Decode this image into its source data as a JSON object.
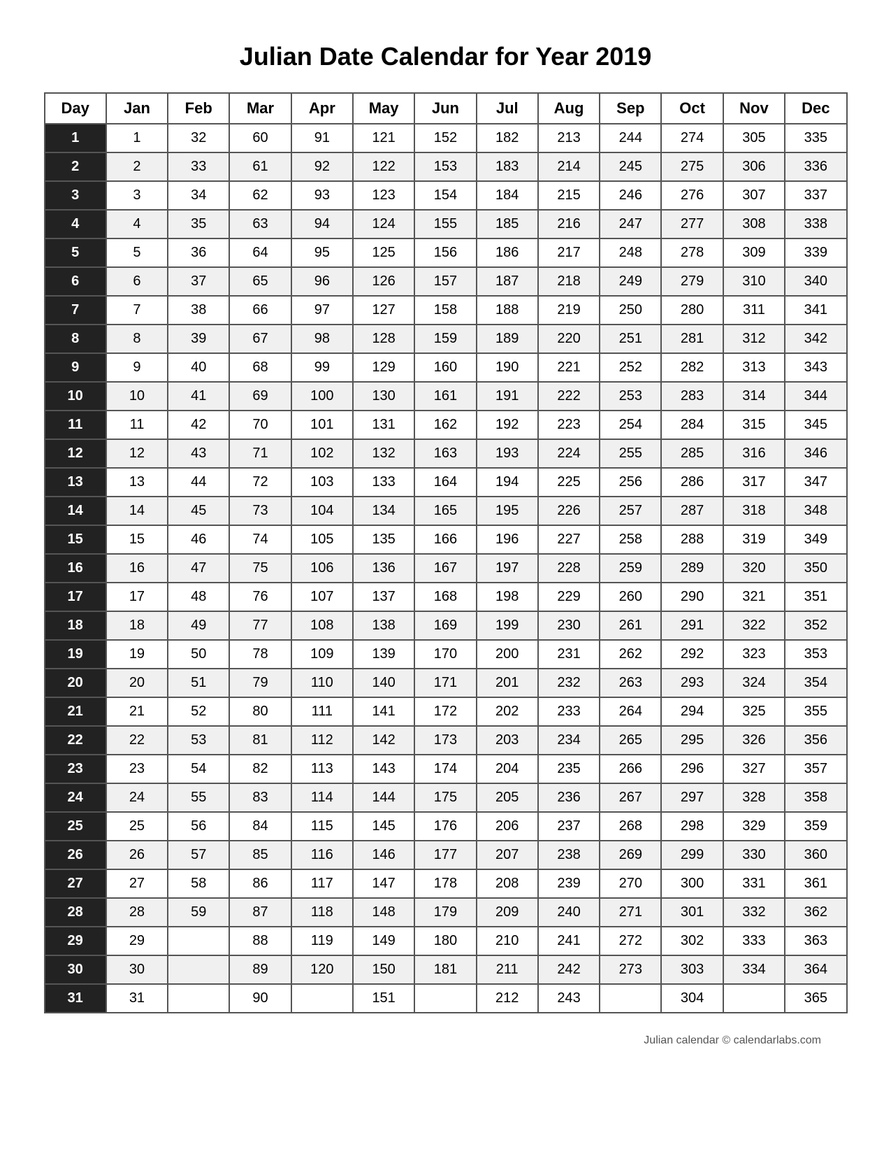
{
  "title": "Julian Date Calendar for Year 2019",
  "footer": "Julian calendar © calendarlabs.com",
  "headers": [
    "Day",
    "Jan",
    "Feb",
    "Mar",
    "Apr",
    "May",
    "Jun",
    "Jul",
    "Aug",
    "Sep",
    "Oct",
    "Nov",
    "Dec"
  ],
  "rows": [
    {
      "day": 1,
      "jan": 1,
      "feb": 32,
      "mar": 60,
      "apr": 91,
      "may": 121,
      "jun": 152,
      "jul": 182,
      "aug": 213,
      "sep": 244,
      "oct": 274,
      "nov": 305,
      "dec": 335
    },
    {
      "day": 2,
      "jan": 2,
      "feb": 33,
      "mar": 61,
      "apr": 92,
      "may": 122,
      "jun": 153,
      "jul": 183,
      "aug": 214,
      "sep": 245,
      "oct": 275,
      "nov": 306,
      "dec": 336
    },
    {
      "day": 3,
      "jan": 3,
      "feb": 34,
      "mar": 62,
      "apr": 93,
      "may": 123,
      "jun": 154,
      "jul": 184,
      "aug": 215,
      "sep": 246,
      "oct": 276,
      "nov": 307,
      "dec": 337
    },
    {
      "day": 4,
      "jan": 4,
      "feb": 35,
      "mar": 63,
      "apr": 94,
      "may": 124,
      "jun": 155,
      "jul": 185,
      "aug": 216,
      "sep": 247,
      "oct": 277,
      "nov": 308,
      "dec": 338
    },
    {
      "day": 5,
      "jan": 5,
      "feb": 36,
      "mar": 64,
      "apr": 95,
      "may": 125,
      "jun": 156,
      "jul": 186,
      "aug": 217,
      "sep": 248,
      "oct": 278,
      "nov": 309,
      "dec": 339
    },
    {
      "day": 6,
      "jan": 6,
      "feb": 37,
      "mar": 65,
      "apr": 96,
      "may": 126,
      "jun": 157,
      "jul": 187,
      "aug": 218,
      "sep": 249,
      "oct": 279,
      "nov": 310,
      "dec": 340
    },
    {
      "day": 7,
      "jan": 7,
      "feb": 38,
      "mar": 66,
      "apr": 97,
      "may": 127,
      "jun": 158,
      "jul": 188,
      "aug": 219,
      "sep": 250,
      "oct": 280,
      "nov": 311,
      "dec": 341
    },
    {
      "day": 8,
      "jan": 8,
      "feb": 39,
      "mar": 67,
      "apr": 98,
      "may": 128,
      "jun": 159,
      "jul": 189,
      "aug": 220,
      "sep": 251,
      "oct": 281,
      "nov": 312,
      "dec": 342
    },
    {
      "day": 9,
      "jan": 9,
      "feb": 40,
      "mar": 68,
      "apr": 99,
      "may": 129,
      "jun": 160,
      "jul": 190,
      "aug": 221,
      "sep": 252,
      "oct": 282,
      "nov": 313,
      "dec": 343
    },
    {
      "day": 10,
      "jan": 10,
      "feb": 41,
      "mar": 69,
      "apr": 100,
      "may": 130,
      "jun": 161,
      "jul": 191,
      "aug": 222,
      "sep": 253,
      "oct": 283,
      "nov": 314,
      "dec": 344
    },
    {
      "day": 11,
      "jan": 11,
      "feb": 42,
      "mar": 70,
      "apr": 101,
      "may": 131,
      "jun": 162,
      "jul": 192,
      "aug": 223,
      "sep": 254,
      "oct": 284,
      "nov": 315,
      "dec": 345
    },
    {
      "day": 12,
      "jan": 12,
      "feb": 43,
      "mar": 71,
      "apr": 102,
      "may": 132,
      "jun": 163,
      "jul": 193,
      "aug": 224,
      "sep": 255,
      "oct": 285,
      "nov": 316,
      "dec": 346
    },
    {
      "day": 13,
      "jan": 13,
      "feb": 44,
      "mar": 72,
      "apr": 103,
      "may": 133,
      "jun": 164,
      "jul": 194,
      "aug": 225,
      "sep": 256,
      "oct": 286,
      "nov": 317,
      "dec": 347
    },
    {
      "day": 14,
      "jan": 14,
      "feb": 45,
      "mar": 73,
      "apr": 104,
      "may": 134,
      "jun": 165,
      "jul": 195,
      "aug": 226,
      "sep": 257,
      "oct": 287,
      "nov": 318,
      "dec": 348
    },
    {
      "day": 15,
      "jan": 15,
      "feb": 46,
      "mar": 74,
      "apr": 105,
      "may": 135,
      "jun": 166,
      "jul": 196,
      "aug": 227,
      "sep": 258,
      "oct": 288,
      "nov": 319,
      "dec": 349
    },
    {
      "day": 16,
      "jan": 16,
      "feb": 47,
      "mar": 75,
      "apr": 106,
      "may": 136,
      "jun": 167,
      "jul": 197,
      "aug": 228,
      "sep": 259,
      "oct": 289,
      "nov": 320,
      "dec": 350
    },
    {
      "day": 17,
      "jan": 17,
      "feb": 48,
      "mar": 76,
      "apr": 107,
      "may": 137,
      "jun": 168,
      "jul": 198,
      "aug": 229,
      "sep": 260,
      "oct": 290,
      "nov": 321,
      "dec": 351
    },
    {
      "day": 18,
      "jan": 18,
      "feb": 49,
      "mar": 77,
      "apr": 108,
      "may": 138,
      "jun": 169,
      "jul": 199,
      "aug": 230,
      "sep": 261,
      "oct": 291,
      "nov": 322,
      "dec": 352
    },
    {
      "day": 19,
      "jan": 19,
      "feb": 50,
      "mar": 78,
      "apr": 109,
      "may": 139,
      "jun": 170,
      "jul": 200,
      "aug": 231,
      "sep": 262,
      "oct": 292,
      "nov": 323,
      "dec": 353
    },
    {
      "day": 20,
      "jan": 20,
      "feb": 51,
      "mar": 79,
      "apr": 110,
      "may": 140,
      "jun": 171,
      "jul": 201,
      "aug": 232,
      "sep": 263,
      "oct": 293,
      "nov": 324,
      "dec": 354
    },
    {
      "day": 21,
      "jan": 21,
      "feb": 52,
      "mar": 80,
      "apr": 111,
      "may": 141,
      "jun": 172,
      "jul": 202,
      "aug": 233,
      "sep": 264,
      "oct": 294,
      "nov": 325,
      "dec": 355
    },
    {
      "day": 22,
      "jan": 22,
      "feb": 53,
      "mar": 81,
      "apr": 112,
      "may": 142,
      "jun": 173,
      "jul": 203,
      "aug": 234,
      "sep": 265,
      "oct": 295,
      "nov": 326,
      "dec": 356
    },
    {
      "day": 23,
      "jan": 23,
      "feb": 54,
      "mar": 82,
      "apr": 113,
      "may": 143,
      "jun": 174,
      "jul": 204,
      "aug": 235,
      "sep": 266,
      "oct": 296,
      "nov": 327,
      "dec": 357
    },
    {
      "day": 24,
      "jan": 24,
      "feb": 55,
      "mar": 83,
      "apr": 114,
      "may": 144,
      "jun": 175,
      "jul": 205,
      "aug": 236,
      "sep": 267,
      "oct": 297,
      "nov": 328,
      "dec": 358
    },
    {
      "day": 25,
      "jan": 25,
      "feb": 56,
      "mar": 84,
      "apr": 115,
      "may": 145,
      "jun": 176,
      "jul": 206,
      "aug": 237,
      "sep": 268,
      "oct": 298,
      "nov": 329,
      "dec": 359
    },
    {
      "day": 26,
      "jan": 26,
      "feb": 57,
      "mar": 85,
      "apr": 116,
      "may": 146,
      "jun": 177,
      "jul": 207,
      "aug": 238,
      "sep": 269,
      "oct": 299,
      "nov": 330,
      "dec": 360
    },
    {
      "day": 27,
      "jan": 27,
      "feb": 58,
      "mar": 86,
      "apr": 117,
      "may": 147,
      "jun": 178,
      "jul": 208,
      "aug": 239,
      "sep": 270,
      "oct": 300,
      "nov": 331,
      "dec": 361
    },
    {
      "day": 28,
      "jan": 28,
      "feb": 59,
      "mar": 87,
      "apr": 118,
      "may": 148,
      "jun": 179,
      "jul": 209,
      "aug": 240,
      "sep": 271,
      "oct": 301,
      "nov": 332,
      "dec": 362
    },
    {
      "day": 29,
      "jan": 29,
      "feb": "",
      "mar": 88,
      "apr": 119,
      "may": 149,
      "jun": 180,
      "jul": 210,
      "aug": 241,
      "sep": 272,
      "oct": 302,
      "nov": 333,
      "dec": 363
    },
    {
      "day": 30,
      "jan": 30,
      "feb": "",
      "mar": 89,
      "apr": 120,
      "may": 150,
      "jun": 181,
      "jul": 211,
      "aug": 242,
      "sep": 273,
      "oct": 303,
      "nov": 334,
      "dec": 364
    },
    {
      "day": 31,
      "jan": 31,
      "feb": "",
      "mar": 90,
      "apr": "",
      "may": 151,
      "jun": "",
      "jul": 212,
      "aug": 243,
      "sep": "",
      "oct": 304,
      "nov": "",
      "dec": 365
    }
  ]
}
